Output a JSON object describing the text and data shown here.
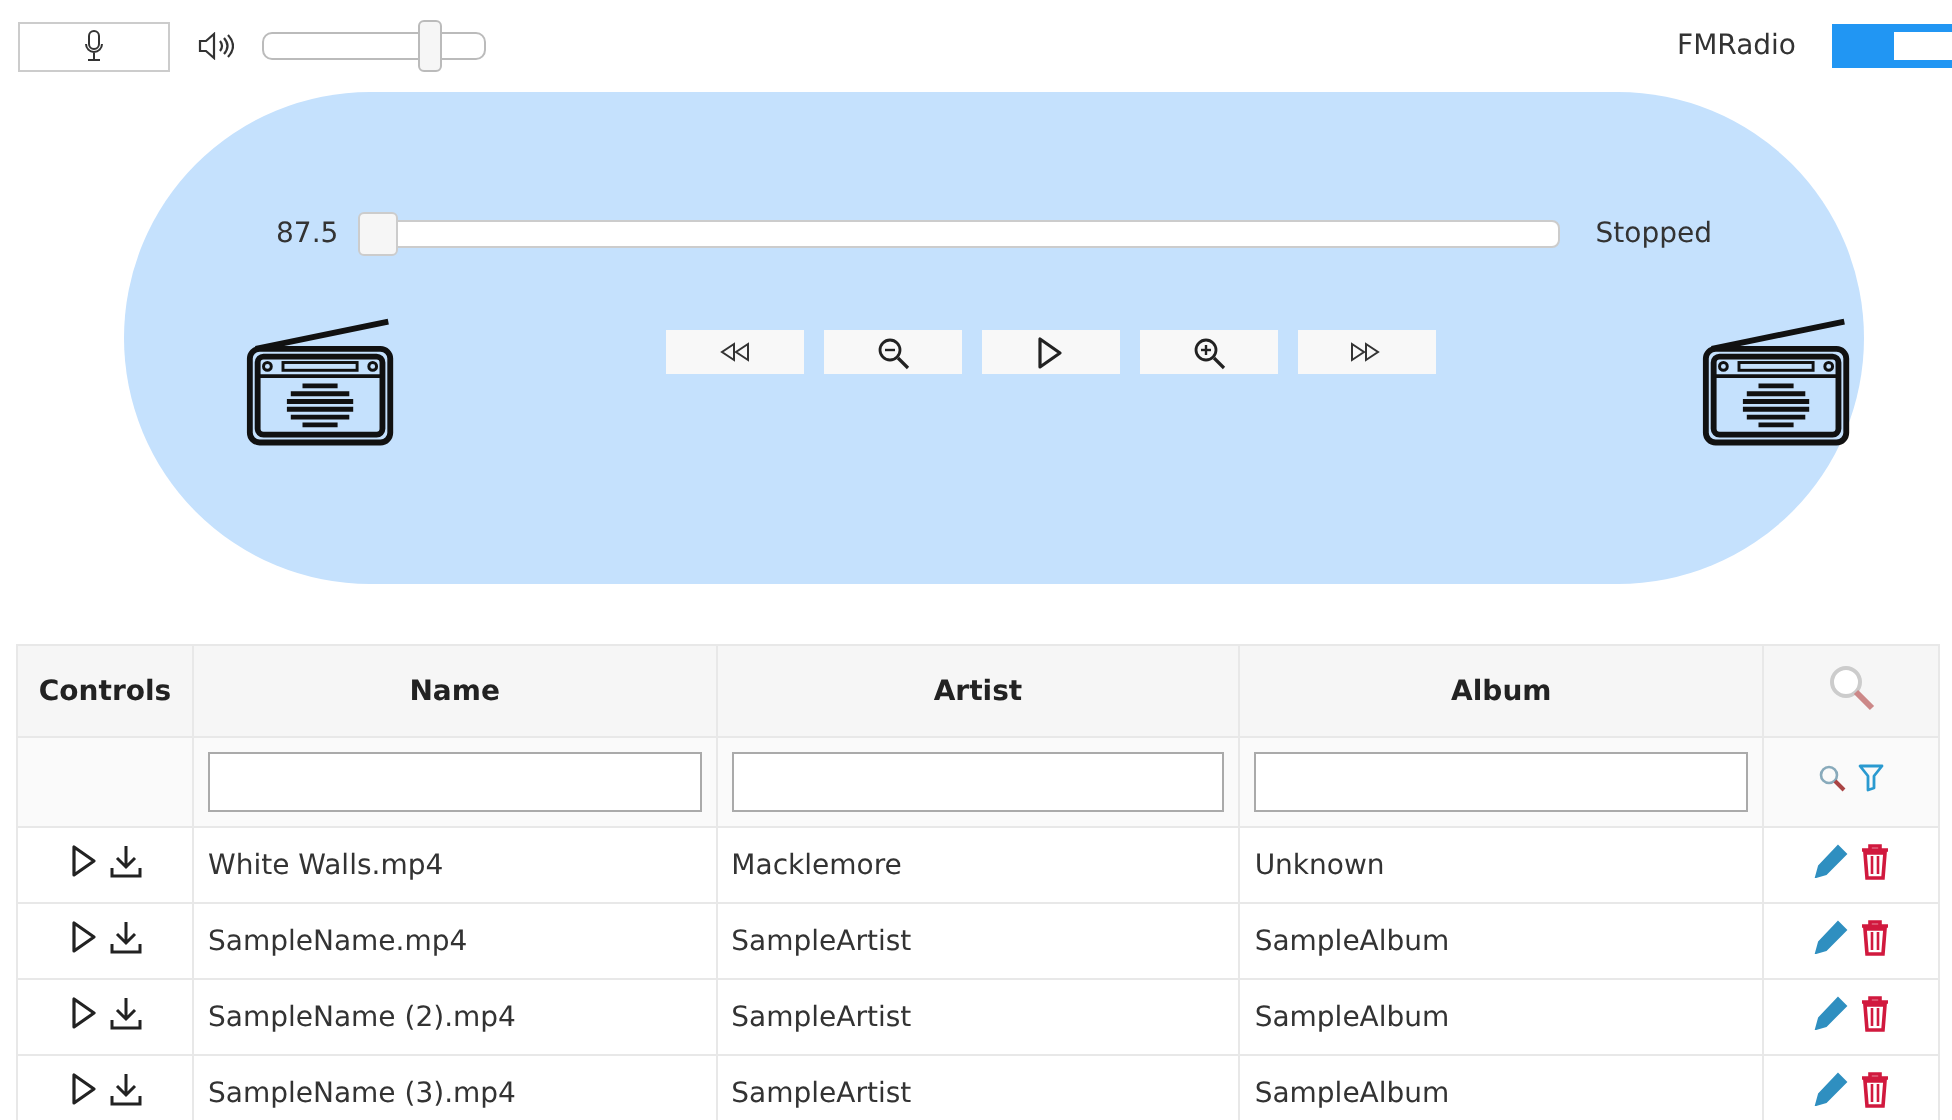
{
  "toolbar": {
    "volume": {
      "level": 0.75
    },
    "radio_label": "FMRadio",
    "radio_toggle": {
      "on": true
    }
  },
  "player": {
    "frequency": "87.5",
    "tuner": {
      "level": 0
    },
    "status": "Stopped"
  },
  "table": {
    "columns": [
      "Controls",
      "Name",
      "Artist",
      "Album"
    ],
    "rows": [
      {
        "name": "White Walls.mp4",
        "artist": "Macklemore",
        "album": "Unknown"
      },
      {
        "name": "SampleName.mp4",
        "artist": "SampleArtist",
        "album": "SampleAlbum"
      },
      {
        "name": "SampleName (2).mp4",
        "artist": "SampleArtist",
        "album": "SampleAlbum"
      },
      {
        "name": "SampleName (3).mp4",
        "artist": "SampleArtist",
        "album": "SampleAlbum"
      }
    ]
  }
}
